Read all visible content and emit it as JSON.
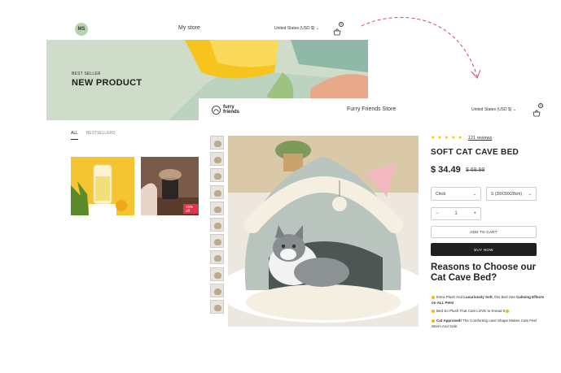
{
  "back_store": {
    "avatar_initials": "MS",
    "title": "My store",
    "country": "United States (USD $)",
    "cart_count": "0",
    "hero": {
      "eyebrow": "BEST SELLER",
      "title": "NEW PRODUCT"
    },
    "tabs": [
      "ALL",
      "BESTSELLERS"
    ],
    "sale_badge": "15% off"
  },
  "front_store": {
    "logo_line1": "furry",
    "logo_line2": "friends",
    "title": "Furry Friends Store",
    "country": "United States (USD $)",
    "cart_count": "0",
    "product": {
      "stars": "★★★★★",
      "reviews": "121 reviews",
      "title": "SOFT CAT CAVE BED",
      "price": "$ 34.49",
      "compare_price": "$ 68.99",
      "color_value": "Chick",
      "size_value": "S (39X39X28cm)",
      "quantity": "1",
      "add_to_cart": "ADD TO CART",
      "buy_now": "BUY NOW",
      "reasons_heading": "Reasons to Choose our Cat Cave Bed?",
      "bullets": [
        {
          "pre": "Extra Plush And ",
          "bold": "Luxuriously Soft",
          "post": ", this Bed Has ",
          "bold2": "Calming Effects on ALL Pets!",
          "post2": ""
        },
        {
          "pre": "Bed So Plush That Cats LOVE to Knead It",
          "bold": "",
          "post": "",
          "bold2": "",
          "post2": ""
        },
        {
          "pre": "",
          "bold": "Cat Approved!",
          "post": " The Comforting cave Shape Makes Cats Feel Warm And Safe.",
          "bold2": "",
          "post2": ""
        }
      ]
    }
  },
  "colors": {
    "accent_pink": "#e23e7a",
    "star_yellow": "#f2c200",
    "hero_bg": "#cfdcc9",
    "buy_button": "#1f1f1f"
  },
  "icons": [
    "cart-icon",
    "chevron-down-icon",
    "star-icon",
    "paw-logo-icon",
    "dashed-arrow"
  ]
}
